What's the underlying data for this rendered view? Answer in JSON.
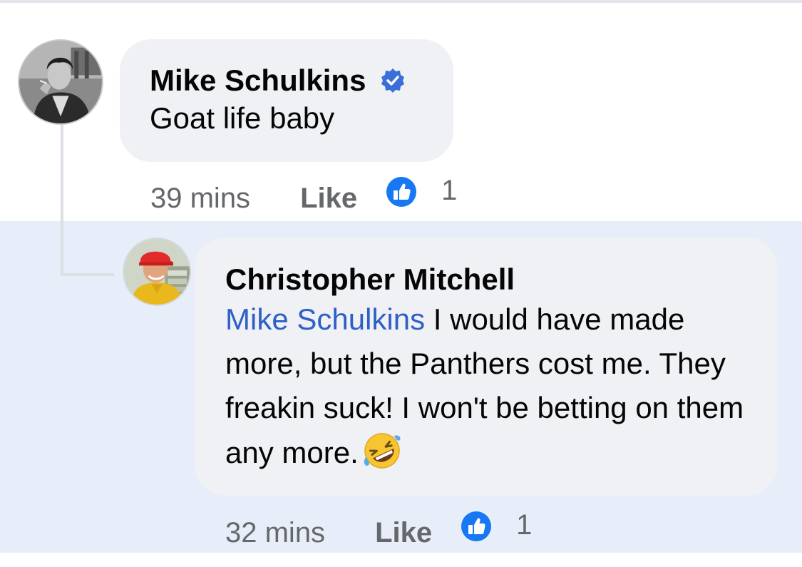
{
  "comments": [
    {
      "author": "Mike Schulkins",
      "verified": true,
      "text": "Goat life baby",
      "time": "39 mins",
      "like_label": "Like",
      "reaction_icon": "like-reaction-icon",
      "reaction_count": "1"
    },
    {
      "author": "Christopher Mitchell",
      "verified": false,
      "mention": "Mike Schulkins",
      "text": " I would have made more, but the Panthers cost me. They freakin suck! I won't be betting on them any more.",
      "emoji": "rolling-on-floor-laughing-emoji",
      "time": "32 mins",
      "like_label": "Like",
      "reaction_icon": "like-reaction-icon",
      "reaction_count": "1",
      "highlighted": true
    }
  ],
  "colors": {
    "bubble": "#eff1f4",
    "highlight": "#e8eef9",
    "mention": "#2f60c8",
    "verified": "#3b6fd8",
    "reaction": "#1877f2",
    "meta_text": "#65676b"
  }
}
